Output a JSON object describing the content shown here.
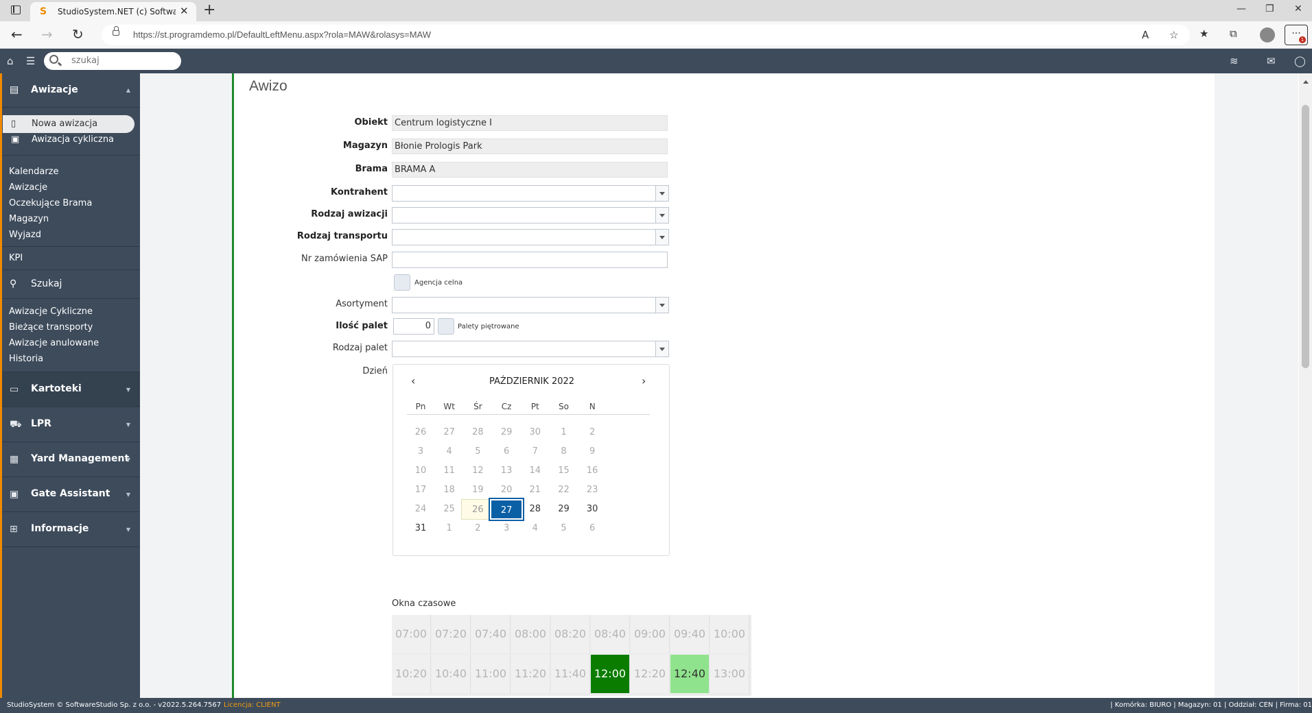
{
  "browser": {
    "tab_title": "StudioSystem.NET (c) SoftwareSt",
    "url_prefix": "https://st.programdemo.pl",
    "url_path": "/DefaultLeftMenu.aspx?rola=MAW&rolasys=MAW"
  },
  "appbar": {
    "search_placeholder": "szukaj"
  },
  "sidebar": {
    "section_main": "Awizacje",
    "sub_items": [
      {
        "label": "Nowa awizacja",
        "icon": "document-icon"
      },
      {
        "label": "Awizacja cykliczna",
        "icon": "calendar-add-icon"
      }
    ],
    "links_1": [
      "Kalendarze",
      "Awizacje",
      "Oczekujące Brama",
      "Magazyn",
      "Wyjazd"
    ],
    "kpi": "KPI",
    "search_label": "Szukaj",
    "links_2": [
      "Awizacje Cykliczne",
      "Bieżące transporty",
      "Awizacje anulowane",
      "Historia"
    ],
    "categories": [
      {
        "label": "Kartoteki",
        "icon": "folder-icon"
      },
      {
        "label": "LPR",
        "icon": "truck-icon"
      },
      {
        "label": "Yard Management",
        "icon": "grid-icon"
      },
      {
        "label": "Gate Assistant",
        "icon": "person-board-icon"
      },
      {
        "label": "Informacje",
        "icon": "sitemap-icon"
      }
    ]
  },
  "form": {
    "title": "Awizo",
    "obiekt_label": "Obiekt",
    "obiekt_value": "Centrum logistyczne I",
    "magazyn_label": "Magazyn",
    "magazyn_value": "Błonie Prologis Park",
    "brama_label": "Brama",
    "brama_value": "BRAMA A",
    "kontrahent_label": "Kontrahent",
    "rodzaj_awizacji_label": "Rodzaj awizacji",
    "rodzaj_transportu_label": "Rodzaj transportu",
    "nr_zamowienia_label": "Nr zamówienia SAP",
    "agencja_label": "Agencja celna",
    "asortyment_label": "Asortyment",
    "ilosc_palet_label": "Ilość palet",
    "ilosc_palet_value": "0",
    "palety_pietrowane_label": "Palety piętrowane",
    "rodzaj_palet_label": "Rodzaj palet",
    "dzien_label": "Dzień"
  },
  "calendar": {
    "month_title": "PAŹDZIERNIK 2022",
    "prev": "‹",
    "next": "›",
    "weekdays": [
      "Pn",
      "Wt",
      "Śr",
      "Cz",
      "Pt",
      "So",
      "N"
    ],
    "weeks": [
      [
        "26",
        "27",
        "28",
        "29",
        "30",
        "1",
        "2"
      ],
      [
        "3",
        "4",
        "5",
        "6",
        "7",
        "8",
        "9"
      ],
      [
        "10",
        "11",
        "12",
        "13",
        "14",
        "15",
        "16"
      ],
      [
        "17",
        "18",
        "19",
        "20",
        "21",
        "22",
        "23"
      ],
      [
        "24",
        "25",
        "26",
        "27",
        "28",
        "29",
        "30"
      ],
      [
        "31",
        "1",
        "2",
        "3",
        "4",
        "5",
        "6"
      ]
    ],
    "today": "26",
    "selected": "27"
  },
  "time_windows": {
    "label": "Okna czasowe",
    "row1": [
      "07:00",
      "07:20",
      "07:40",
      "08:00",
      "08:20",
      "08:40",
      "09:00",
      "09:40",
      "10:00"
    ],
    "row2": [
      "10:20",
      "10:40",
      "11:00",
      "11:20",
      "11:40",
      "12:00",
      "12:20",
      "12:40",
      "13:00"
    ],
    "highlight_dark": "12:00",
    "highlight_light": "12:40"
  },
  "footer": {
    "left": "StudioSystem © SoftwareStudio Sp. z o.o. - v2022.5.264.7567",
    "license": "Licencja: CLIENT",
    "right": "| Komórka: BIURO | Magazyn: 01 | Oddział: CEN | Firma: 01"
  }
}
